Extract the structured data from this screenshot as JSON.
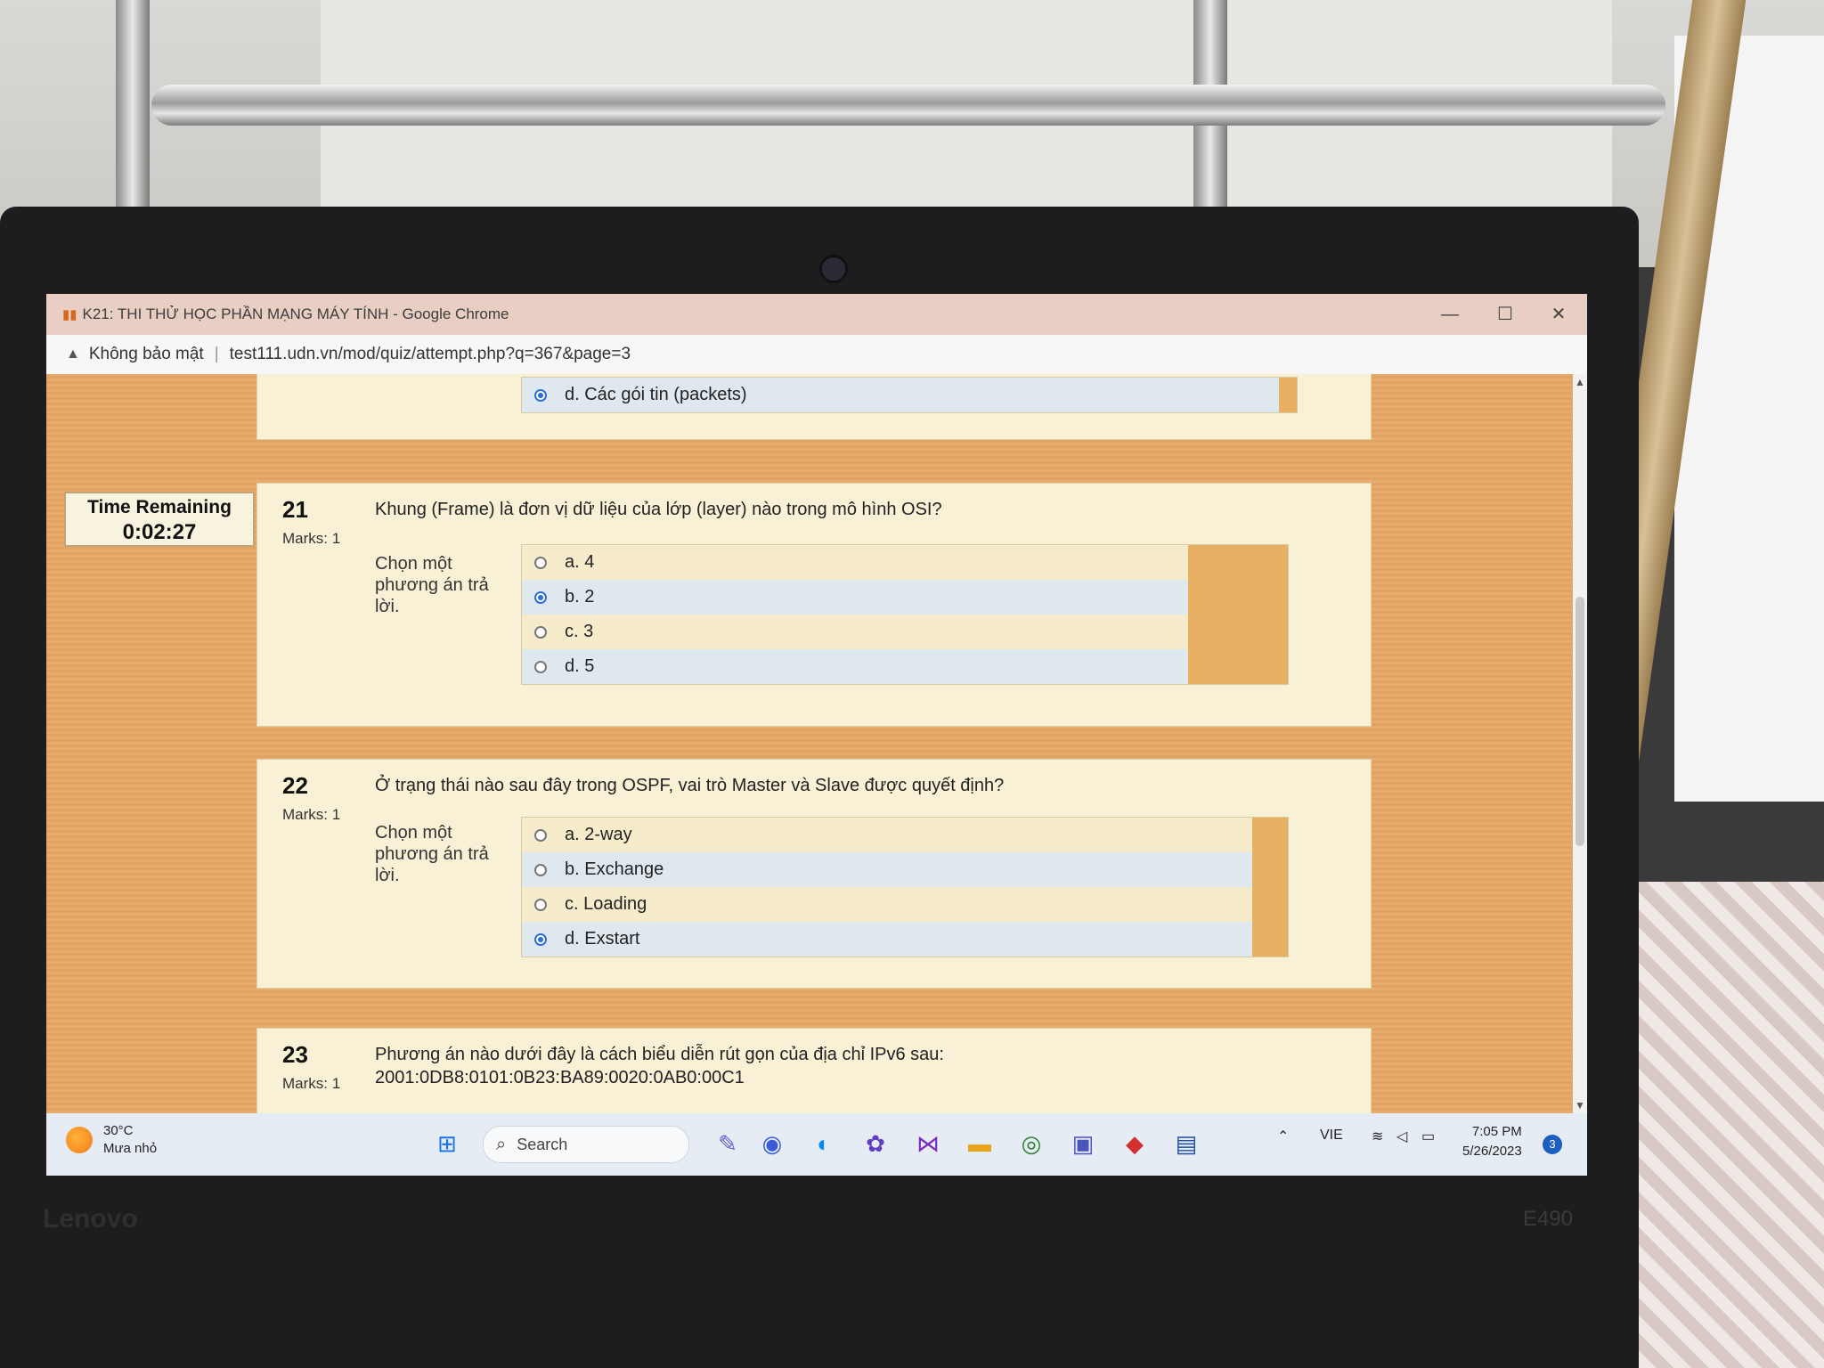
{
  "window": {
    "title": "K21: THI THỬ HỌC PHẦN MẠNG MÁY TÍNH - Google Chrome",
    "minimize_glyph": "—",
    "maximize_glyph": "☐",
    "close_glyph": "✕"
  },
  "address_bar": {
    "security_label": "Không bảo mật",
    "url": "test111.udn.vn/mod/quiz/attempt.php?q=367&page=3"
  },
  "timer": {
    "label": "Time Remaining",
    "value": "0:02:27"
  },
  "prev_question": {
    "option": {
      "label": "d. Các gói tin (packets)",
      "checked": true
    }
  },
  "questions": [
    {
      "number": "21",
      "marks": "Marks: 1",
      "text": "Khung (Frame) là đơn vị dữ liệu của lớp (layer) nào trong mô hình OSI?",
      "prompt": "Chọn một phương án trả lời.",
      "options": [
        {
          "label": "a. 4",
          "checked": false
        },
        {
          "label": "b. 2",
          "checked": true
        },
        {
          "label": "c. 3",
          "checked": false
        },
        {
          "label": "d. 5",
          "checked": false
        }
      ]
    },
    {
      "number": "22",
      "marks": "Marks: 1",
      "text": "Ở trạng thái nào sau đây trong OSPF, vai trò Master và Slave được quyết định?",
      "prompt": "Chọn một phương án trả lời.",
      "options": [
        {
          "label": "a. 2-way",
          "checked": false
        },
        {
          "label": "b. Exchange",
          "checked": false
        },
        {
          "label": "c. Loading",
          "checked": false
        },
        {
          "label": "d. Exstart",
          "checked": true
        }
      ]
    },
    {
      "number": "23",
      "marks": "Marks: 1",
      "text": "Phương án nào dưới đây là cách biểu diễn rút gọn của địa chỉ IPv6 sau:",
      "text2": "2001:0DB8:0101:0B23:BA89:0020:0AB0:00C1"
    }
  ],
  "taskbar": {
    "weather_temp": "30°C",
    "weather_desc": "Mưa nhỏ",
    "search_label": "Search",
    "language": "VIE",
    "time": "7:05 PM",
    "date": "5/26/2023",
    "notification_count": "3"
  },
  "device": {
    "brand": "Lenovo",
    "model": "E490"
  },
  "colors": {
    "page_background": "#e6a866",
    "question_background": "#f8f1d6",
    "selected_radio": "#2f6fd6"
  }
}
